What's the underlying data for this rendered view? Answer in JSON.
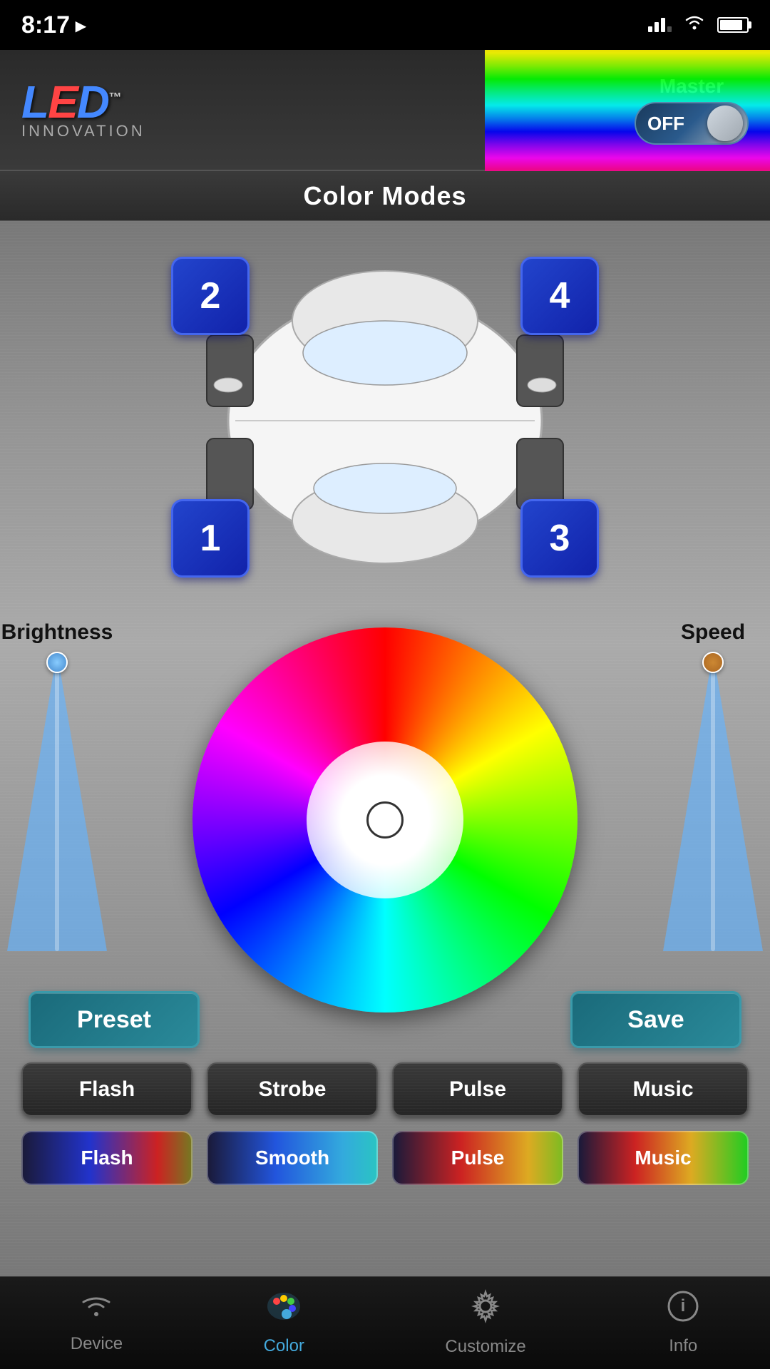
{
  "statusBar": {
    "time": "8:17",
    "navigation_arrow": "▸"
  },
  "header": {
    "logo_l": "L",
    "logo_e": "E",
    "logo_d": "D",
    "logo_tm": "™",
    "logo_innovation": "INNOVATION",
    "master_label": "Master",
    "toggle_label": "OFF"
  },
  "colorModesBar": {
    "title": "Color Modes"
  },
  "zones": [
    {
      "id": "zone-2",
      "label": "2"
    },
    {
      "id": "zone-4",
      "label": "4"
    },
    {
      "id": "zone-1",
      "label": "1"
    },
    {
      "id": "zone-3",
      "label": "3"
    }
  ],
  "sliders": {
    "brightness_label": "Brightness",
    "speed_label": "Speed"
  },
  "buttons": {
    "preset_label": "Preset",
    "save_label": "Save",
    "flash_label": "Flash",
    "strobe_label": "Strobe",
    "pulse_label": "Pulse",
    "music_label": "Music"
  },
  "presetButtons": [
    {
      "id": "preset-flash",
      "label": "Flash",
      "style": "flash"
    },
    {
      "id": "preset-smooth",
      "label": "Smooth",
      "style": "smooth"
    },
    {
      "id": "preset-pulse",
      "label": "Pulse",
      "style": "pulse"
    },
    {
      "id": "preset-music",
      "label": "Music",
      "style": "music"
    }
  ],
  "bottomNav": [
    {
      "id": "nav-device",
      "icon": "wifi",
      "label": "Device",
      "active": false
    },
    {
      "id": "nav-color",
      "icon": "palette",
      "label": "Color",
      "active": true
    },
    {
      "id": "nav-customize",
      "icon": "gear",
      "label": "Customize",
      "active": false
    },
    {
      "id": "nav-info",
      "icon": "info",
      "label": "Info",
      "active": false
    }
  ]
}
